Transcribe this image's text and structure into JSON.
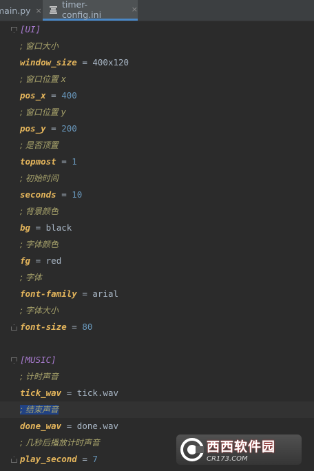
{
  "tabs": {
    "main": {
      "label": "main.py",
      "close": "×"
    },
    "active": {
      "label": "timer-config.ini",
      "icon": "ini-file-icon",
      "close": "×"
    }
  },
  "editor": {
    "lines": [
      {
        "section": "[UI]"
      },
      {
        "comment": "; 窗口大小"
      },
      {
        "key": "window_size",
        "eq": " = ",
        "value": "400x120"
      },
      {
        "comment": "; 窗口位置 x"
      },
      {
        "key": "pos_x",
        "eq": " = ",
        "value": "400"
      },
      {
        "comment": "; 窗口位置 y"
      },
      {
        "key": "pos_y",
        "eq": " = ",
        "value": "200"
      },
      {
        "comment": "; 是否顶置"
      },
      {
        "key": "topmost",
        "eq": " = ",
        "value": "1"
      },
      {
        "comment": "; 初始时间"
      },
      {
        "key": "seconds",
        "eq": " = ",
        "value": "10"
      },
      {
        "comment": "; 背景颜色"
      },
      {
        "key": "bg",
        "eq": " = ",
        "value": "black"
      },
      {
        "comment": "; 字体颜色"
      },
      {
        "key": "fg",
        "eq": " = ",
        "value": "red"
      },
      {
        "comment": "; 字体"
      },
      {
        "key": "font-family",
        "eq": " = ",
        "value": "arial"
      },
      {
        "comment": "; 字体大小"
      },
      {
        "key": "font-size",
        "eq": " = ",
        "value": "80"
      },
      {
        "blank": ""
      },
      {
        "section": "[MUSIC]"
      },
      {
        "comment": "; 计时声音"
      },
      {
        "key": "tick_wav",
        "eq": " = ",
        "value": "tick.wav"
      },
      {
        "comment": "; 结束声音"
      },
      {
        "key": "done_wav",
        "eq": " = ",
        "value": "done.wav"
      },
      {
        "comment": "; 几秒后播放计时声音"
      },
      {
        "key": "play_second",
        "eq": " = ",
        "value": "7"
      }
    ],
    "current_line": 23,
    "highlighted_line": 23
  },
  "watermark": {
    "name": "西西软件园",
    "url": "CR173.COM"
  },
  "colors": {
    "background": "#2b2b2b",
    "section": "#a97bd0",
    "comment": "#a9a46c",
    "key": "#e5b65c",
    "text": "#a9b7c6",
    "tab_underline": "#4a88c7"
  }
}
